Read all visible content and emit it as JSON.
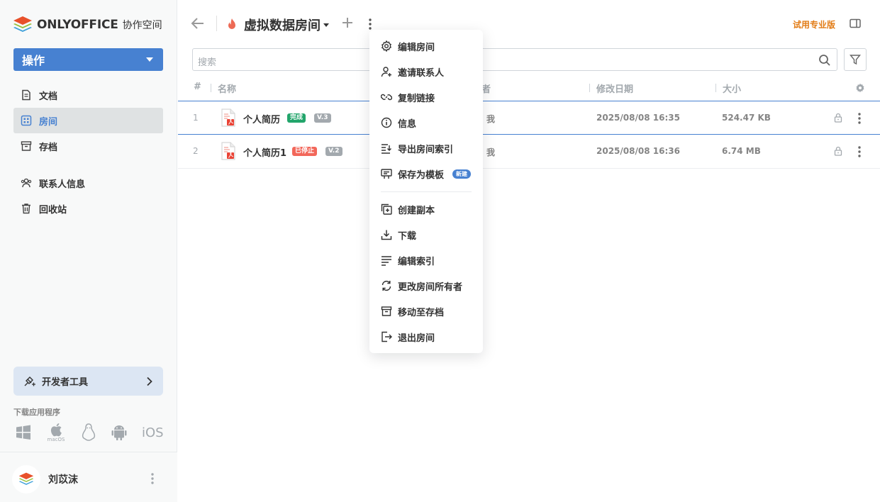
{
  "app": {
    "logo_text": "ONLYOFFICE",
    "logo_sub": "协作空间"
  },
  "sidebar": {
    "action_label": "操作",
    "nav_primary": [
      {
        "label": "文档",
        "icon": "document-icon"
      },
      {
        "label": "房间",
        "icon": "rooms-grid-icon",
        "active": true
      },
      {
        "label": "存档",
        "icon": "archive-icon"
      }
    ],
    "nav_secondary": [
      {
        "label": "联系人信息",
        "icon": "contacts-icon"
      },
      {
        "label": "回收站",
        "icon": "trash-icon"
      }
    ],
    "dev_tools_label": "开发者工具",
    "download_apps_label": "下载应用程序",
    "apps": [
      "windows-icon",
      "macos-icon",
      "linux-icon",
      "android-icon",
      "iOS"
    ],
    "apps_macos_label": "macOS",
    "user_name": "刘苡沫"
  },
  "header": {
    "room_title": "虚拟数据房间",
    "trial_label": "试用专业版"
  },
  "search": {
    "placeholder": "搜索"
  },
  "table": {
    "columns": {
      "index": "#",
      "name": "名称",
      "owner": "者",
      "modified": "修改日期",
      "size": "大小"
    },
    "rows": [
      {
        "index": "1",
        "name": "个人简历",
        "status": "完成",
        "status_color": "#22a56b",
        "version": "V.3",
        "owner": "我",
        "modified": "2025/08/08 16:35",
        "size": "524.47 KB"
      },
      {
        "index": "2",
        "name": "个人简历1",
        "status": "已停止",
        "status_color": "#f2675a",
        "version": "V.2",
        "owner": "我",
        "modified": "2025/08/08 16:36",
        "size": "6.74 MB"
      }
    ]
  },
  "context_menu": {
    "items_top": [
      {
        "label": "编辑房间",
        "icon": "gear-icon"
      },
      {
        "label": "邀请联系人",
        "icon": "add-user-icon"
      },
      {
        "label": "复制链接",
        "icon": "link-icon"
      },
      {
        "label": "信息",
        "icon": "info-icon"
      },
      {
        "label": "导出房间索引",
        "icon": "export-index-icon"
      },
      {
        "label": "保存为模板",
        "icon": "template-icon",
        "badge": "新建"
      }
    ],
    "items_bottom": [
      {
        "label": "创建副本",
        "icon": "duplicate-icon"
      },
      {
        "label": "下载",
        "icon": "download-icon"
      },
      {
        "label": "编辑索引",
        "icon": "edit-index-icon"
      },
      {
        "label": "更改房间所有者",
        "icon": "change-owner-icon"
      },
      {
        "label": "移动至存档",
        "icon": "archive-icon"
      },
      {
        "label": "退出房间",
        "icon": "leave-icon"
      }
    ]
  },
  "colors": {
    "accent": "#4781d1",
    "trial": "#e27c16",
    "version_badge": "#a3a9ae"
  }
}
